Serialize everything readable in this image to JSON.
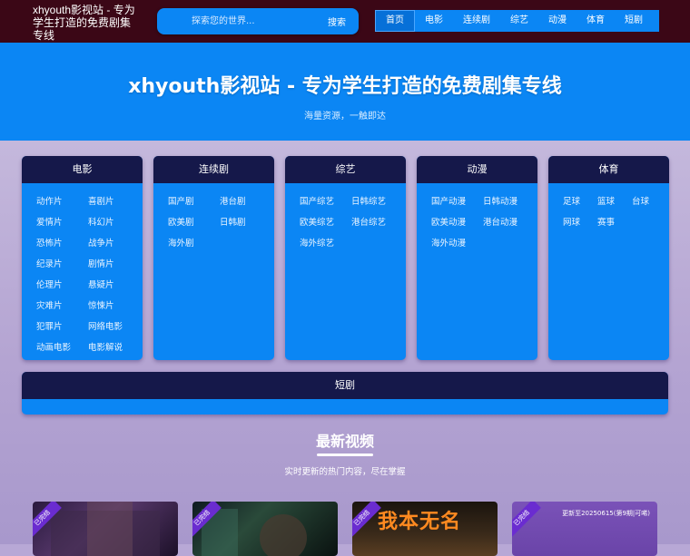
{
  "header": {
    "site_title": "xhyouth影视站 - 专为学生打造的免费剧集专线",
    "search": {
      "placeholder": "探索您的世界...",
      "button": "搜索"
    },
    "nav": [
      "首页",
      "电影",
      "连续剧",
      "综艺",
      "动漫",
      "体育",
      "短剧"
    ]
  },
  "hero": {
    "title": "xhyouth影视站 - 专为学生打造的免费剧集专线",
    "subtitle": "海量资源，一触即达"
  },
  "categories": [
    {
      "title": "电影",
      "links": [
        "动作片",
        "喜剧片",
        "爱情片",
        "科幻片",
        "恐怖片",
        "战争片",
        "纪录片",
        "剧情片",
        "伦理片",
        "悬疑片",
        "灾难片",
        "惊悚片",
        "犯罪片",
        "网络电影",
        "动画电影",
        "电影解说"
      ]
    },
    {
      "title": "连续剧",
      "links": [
        "国产剧",
        "港台剧",
        "欧美剧",
        "日韩剧",
        "海外剧"
      ]
    },
    {
      "title": "综艺",
      "links": [
        "国产综艺",
        "日韩综艺",
        "欧美综艺",
        "港台综艺",
        "海外综艺"
      ]
    },
    {
      "title": "动漫",
      "links": [
        "国产动漫",
        "日韩动漫",
        "欧美动漫",
        "港台动漫",
        "海外动漫"
      ]
    },
    {
      "title": "体育",
      "links": [
        "足球",
        "篮球",
        "台球",
        "网球",
        "赛事"
      ]
    }
  ],
  "short_drama": {
    "title": "短剧"
  },
  "latest": {
    "title": "最新视频",
    "subtitle": "实时更新的热门内容，尽在掌握",
    "items": [
      {
        "badge": "已完结",
        "update": "",
        "poster_text": ""
      },
      {
        "badge": "已完结",
        "update": "",
        "poster_text": ""
      },
      {
        "badge": "已完结",
        "update": "",
        "poster_text": "我本无名"
      },
      {
        "badge": "已完结",
        "update": "更新至20250615(第9期|可唏)",
        "poster_text": ""
      }
    ]
  },
  "colors": {
    "topbar": "#3b0716",
    "accent": "#0b86f4",
    "card_head": "#15184a",
    "badge": "#6a2cd0"
  }
}
